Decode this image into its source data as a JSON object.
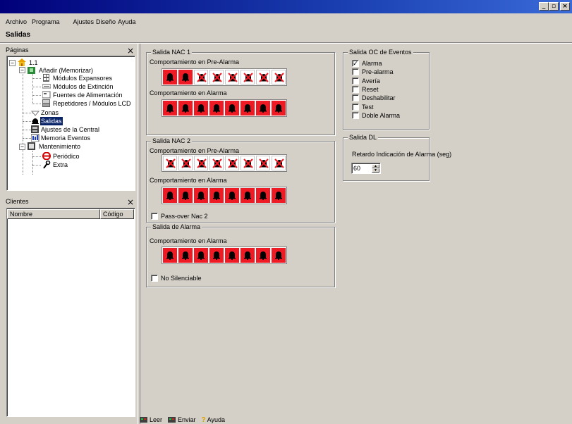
{
  "window": {
    "minimize_glyph": "_",
    "maximize_glyph": "▫",
    "close_glyph": "×"
  },
  "menu": {
    "archivo": "Archivo",
    "programa": "Programa",
    "ajustes": "Ajustes",
    "diseno": "Diseño",
    "ayuda": "Ayuda"
  },
  "page_heading": "Salidas",
  "paginas_panel": {
    "title": "Páginas",
    "close": "×",
    "tree": {
      "root": "1.1",
      "anadir": "Añadir (Memorizar)",
      "modulos_expansores": "Módulos Expansores",
      "modulos_extincion": "Módulos de Extinción",
      "fuentes_alimentacion": "Fuentes de Alimentación",
      "repetidores": "Repetidores / Módulos LCD",
      "zonas": "Zonas",
      "salidas": "Salidas",
      "ajustes_central": "Ajustes de la Central",
      "memoria_eventos": "Memoria Eventos",
      "mantenimiento": "Mantenimiento",
      "periodico": "Periódico",
      "extra": "Extra"
    }
  },
  "clientes_panel": {
    "title": "Clientes",
    "close": "×",
    "columns": [
      "Nombre",
      "Código"
    ]
  },
  "nac1": {
    "title": "Salida NAC 1",
    "pre_alarma_label": "Comportamiento en Pre-Alarma",
    "pre_alarma_cells": [
      "on",
      "on",
      "off",
      "off",
      "off",
      "off",
      "off",
      "off"
    ],
    "alarma_label": "Comportamiento en Alarma",
    "alarma_cells": [
      "on",
      "on",
      "on",
      "on",
      "on",
      "on",
      "on",
      "on"
    ]
  },
  "nac2": {
    "title": "Salida NAC 2",
    "pre_alarma_label": "Comportamiento en Pre-Alarma",
    "pre_alarma_cells": [
      "off",
      "off",
      "off",
      "off",
      "off",
      "off",
      "off",
      "off"
    ],
    "alarma_label": "Comportamiento en Alarma",
    "alarma_cells": [
      "on",
      "on",
      "on",
      "on",
      "on",
      "on",
      "on",
      "on"
    ],
    "passover_label": "Pass-over Nac 2",
    "passover_checked": false
  },
  "alarma_out": {
    "title": "Salida de Alarma",
    "alarma_label": "Comportamiento en Alarma",
    "alarma_cells": [
      "on",
      "on",
      "on",
      "on",
      "on",
      "on",
      "on",
      "on"
    ],
    "no_silenciable_label": "No Silenciable",
    "no_silenciable_checked": false
  },
  "oc_eventos": {
    "title": "Salida OC de Eventos",
    "options": [
      {
        "label": "Alarma",
        "checked": true
      },
      {
        "label": "Pre-alarma",
        "checked": false
      },
      {
        "label": "Avería",
        "checked": false
      },
      {
        "label": "Reset",
        "checked": false
      },
      {
        "label": "Deshabilitar",
        "checked": false
      },
      {
        "label": "Test",
        "checked": false
      },
      {
        "label": "Doble Alarma",
        "checked": false
      }
    ]
  },
  "dl": {
    "title": "Salida DL",
    "retardo_label": "Retardo Indicación de Alarma (seg)",
    "retardo_value": "60"
  },
  "statusbar": {
    "leer": "Leer",
    "enviar": "Enviar",
    "ayuda": "Ayuda"
  },
  "colors": {
    "active_red": "#ee1b24",
    "titlebar_blue": "#0a246a",
    "panel_gray": "#d4d0c8"
  }
}
